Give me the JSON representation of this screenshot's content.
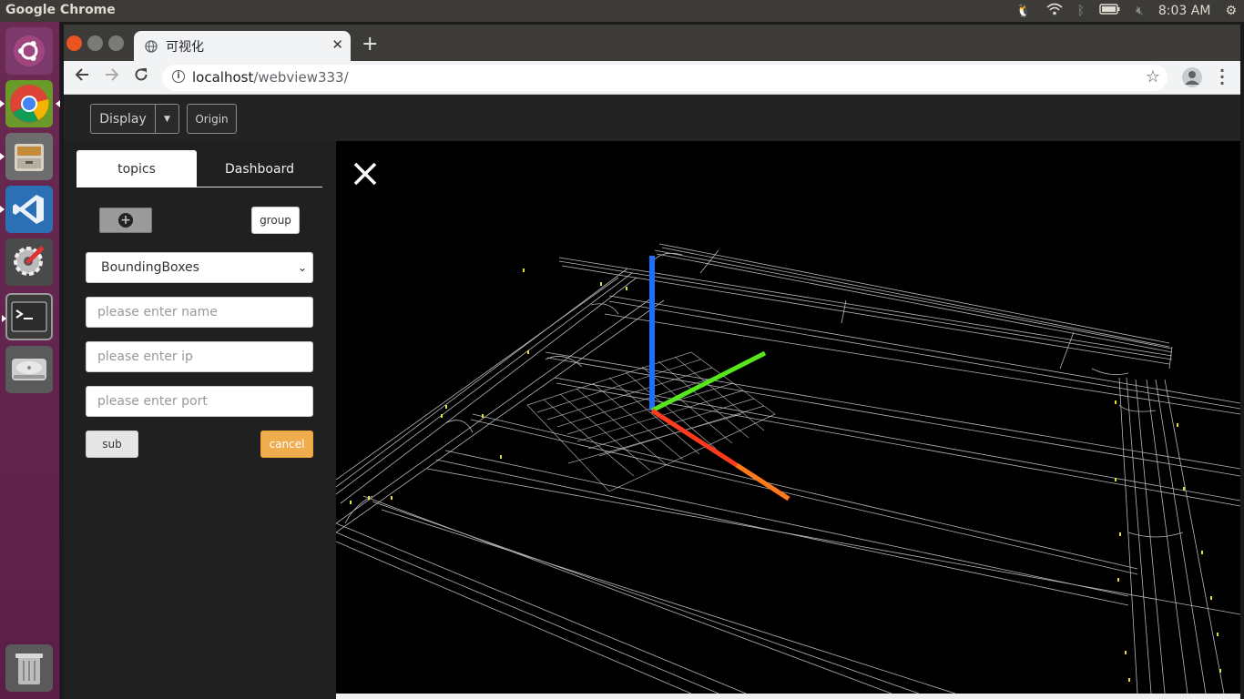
{
  "system": {
    "app_name": "Google Chrome",
    "clock": "8:03 AM",
    "tray_icons": [
      "penguin-icon",
      "wifi-icon",
      "bluetooth-icon",
      "battery-icon",
      "volume-mute-icon",
      "settings-gear-icon"
    ]
  },
  "launcher": {
    "items": [
      "ubuntu-dash-icon",
      "chrome-icon",
      "files-icon",
      "vscode-icon",
      "settings-tools-icon",
      "terminal-icon",
      "disk-icon",
      "trash-icon"
    ]
  },
  "browser": {
    "tab_title": "可视化",
    "new_tab_symbol": "+",
    "url_host": "localhost",
    "url_path": "/webview333/"
  },
  "app": {
    "display_label": "Display",
    "origin_label": "Origin",
    "tabs": {
      "topics": "topics",
      "dashboard": "Dashboard"
    },
    "group_label": "group",
    "type_select_value": "BoundingBoxes",
    "inputs": {
      "name_placeholder": "please enter name",
      "ip_placeholder": "please enter ip",
      "port_placeholder": "please enter port"
    },
    "sub_label": "sub",
    "cancel_label": "cancel"
  },
  "colors": {
    "accent_cancel": "#f0ad4e",
    "axis_x": "#ff3b1f",
    "axis_y": "#55e61e",
    "axis_z": "#1f6fff"
  }
}
